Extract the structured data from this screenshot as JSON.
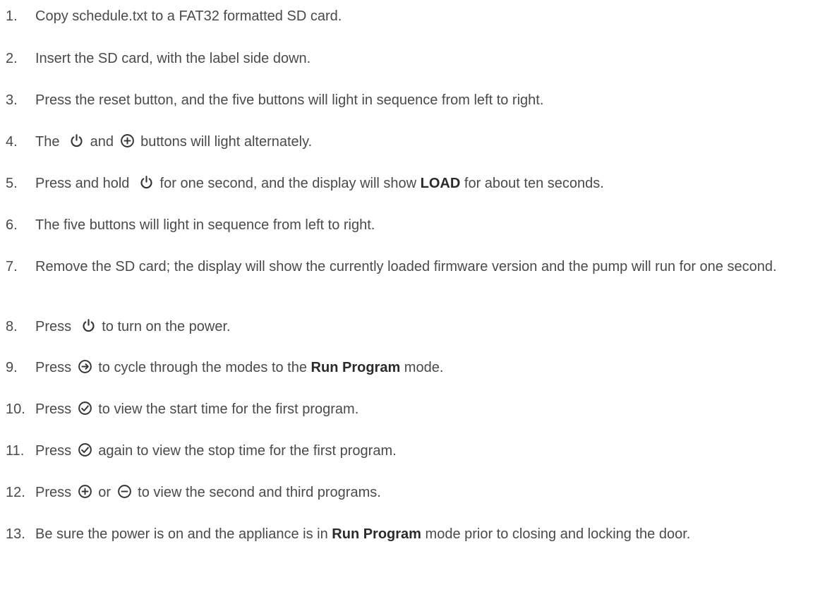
{
  "steps": [
    {
      "number": "1.",
      "text": "Copy schedule.txt to a FAT32 formatted SD card."
    },
    {
      "number": "2.",
      "text": "Insert the SD card, with the label side down."
    },
    {
      "number": "3.",
      "text": "Press the reset button, and the five buttons will light in sequence from left to right."
    },
    {
      "number": "4.",
      "a": "The",
      "b": "and",
      "c": "buttons will light alternately."
    },
    {
      "number": "5.",
      "a": "Press and hold",
      "b": "for one second, and the display will show",
      "bold": "LOAD",
      "c": "for about ten seconds."
    },
    {
      "number": "6.",
      "text": "The five buttons will light in sequence from left to right."
    },
    {
      "number": "7.",
      "text": "Remove the SD card; the display will show the currently loaded firmware version and the pump will run for one second."
    },
    {
      "number": "8.",
      "a": "Press",
      "b": "to turn on the power."
    },
    {
      "number": "9.",
      "a": "Press",
      "b": "to cycle through the modes to the",
      "bold": "Run Program",
      "c": "mode."
    },
    {
      "number": "10.",
      "a": "Press",
      "b": "to view the start time for the first program."
    },
    {
      "number": "11.",
      "a": "Press",
      "b": "again to view the stop time for the first program."
    },
    {
      "number": "12.",
      "a": "Press",
      "b": "or",
      "c": "to view the second and third programs."
    },
    {
      "number": "13.",
      "a": "Be sure the power is on and the appliance is in",
      "bold": "Run Program",
      "b": "mode prior to closing and locking the door."
    }
  ],
  "icons": [
    "power-icon",
    "plus-icon",
    "next-icon",
    "check-icon",
    "minus-icon"
  ],
  "colors": {
    "text": "#4a4a4a",
    "bold_text": "#2b2b2b"
  }
}
